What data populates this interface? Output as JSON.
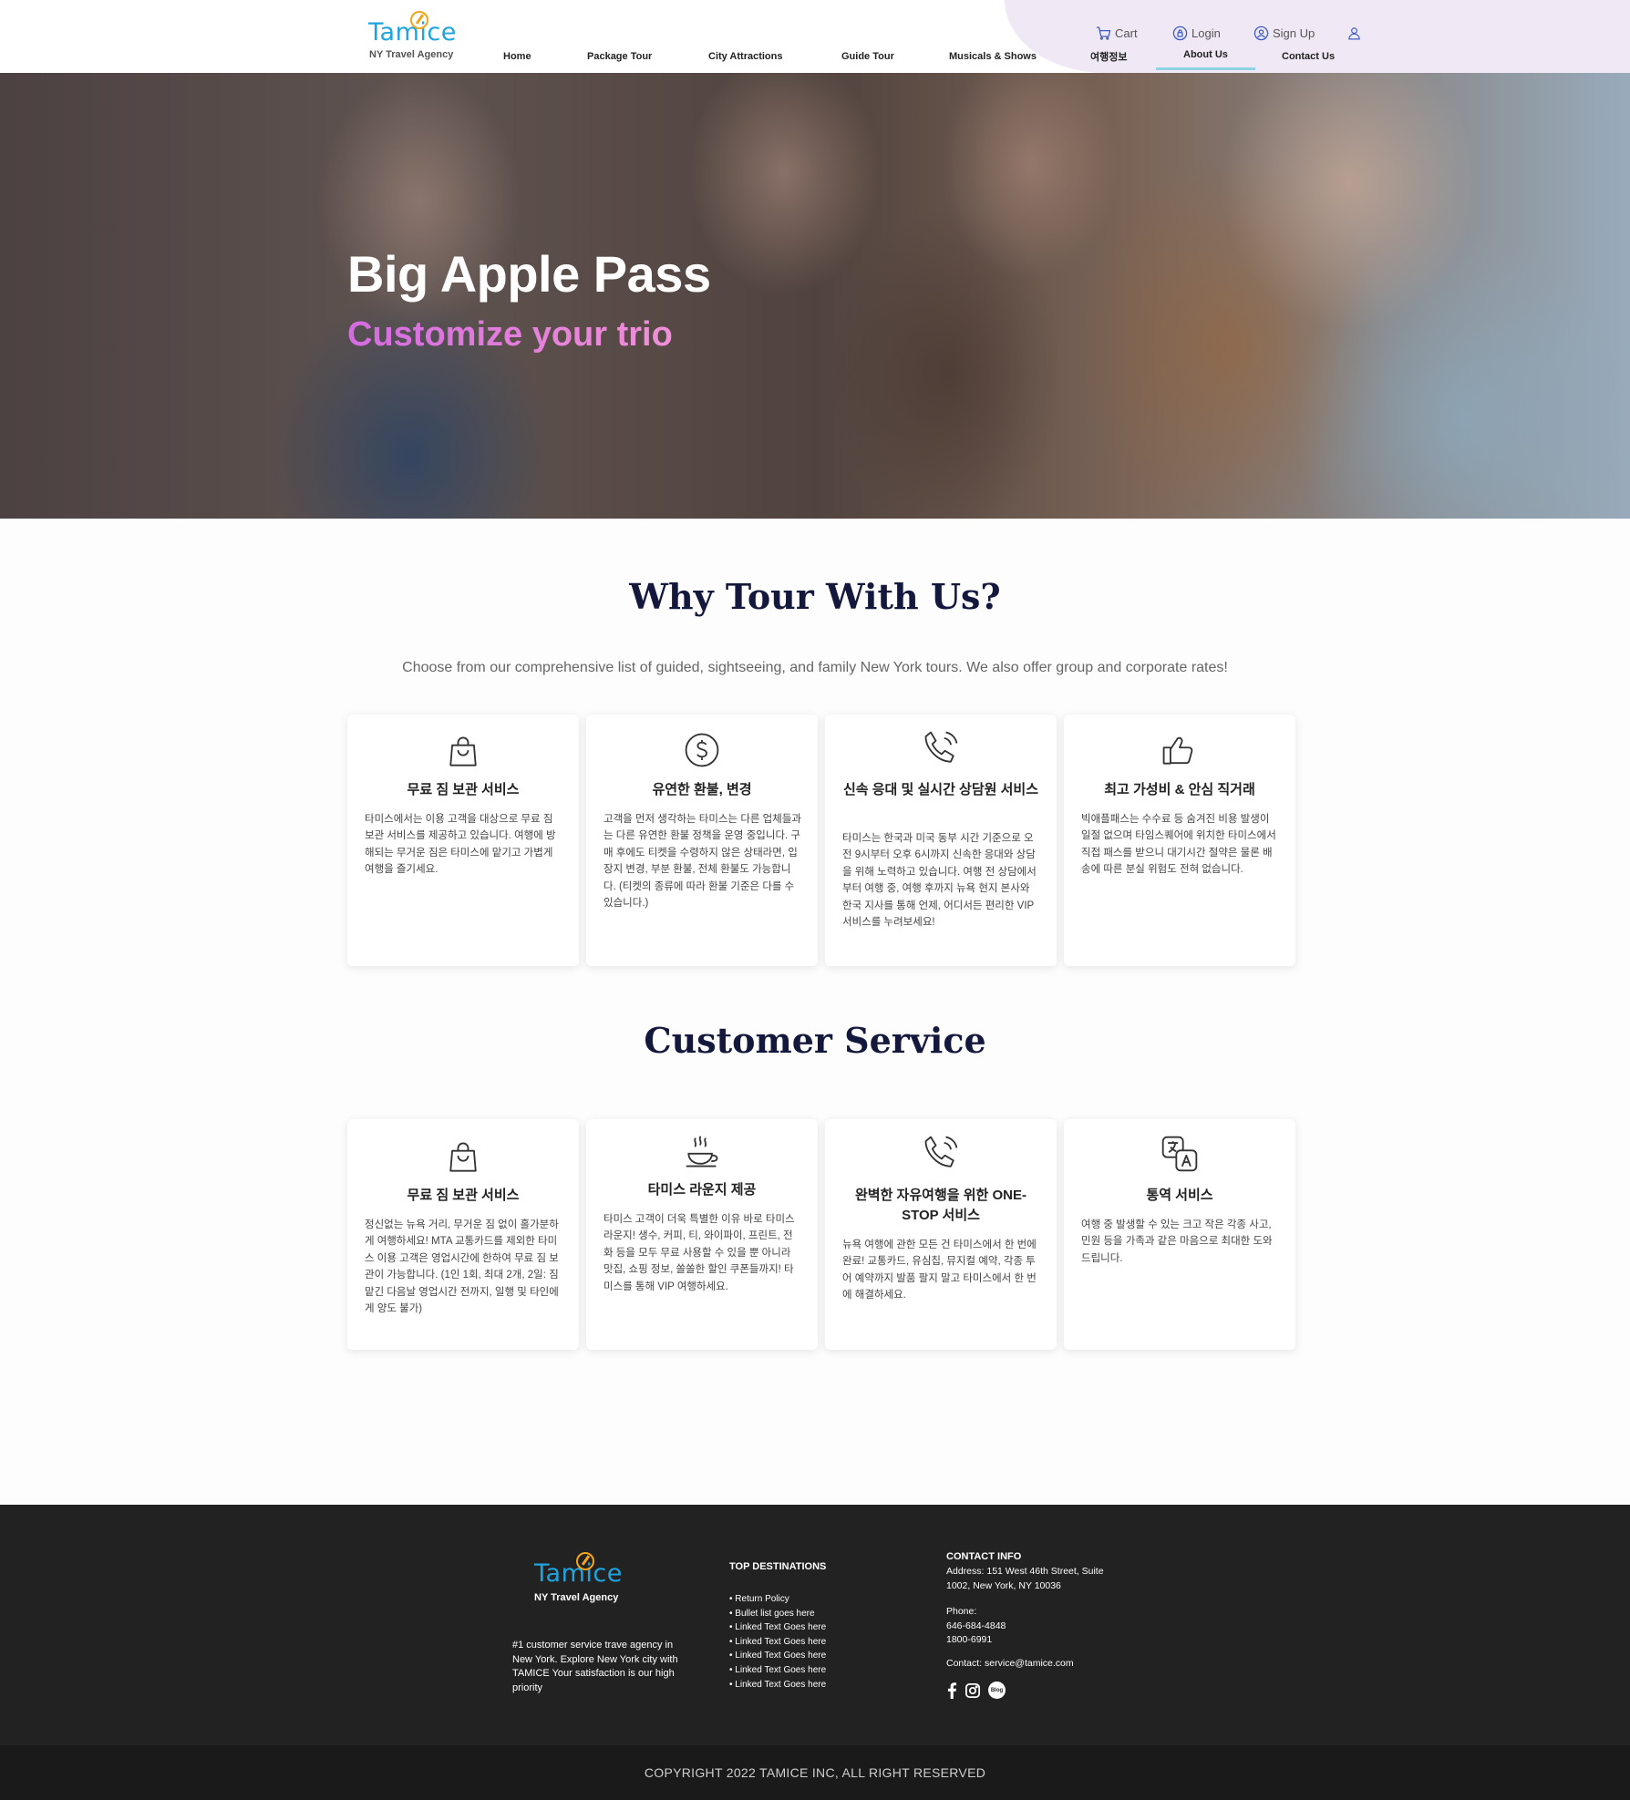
{
  "header": {
    "logo": {
      "word": "Tamice",
      "tagline": "NY Travel Agency"
    },
    "nav": [
      {
        "label": "Home"
      },
      {
        "label": "Package Tour"
      },
      {
        "label": "City Attractions"
      },
      {
        "label": "Guide Tour"
      },
      {
        "label": "Musicals & Shows"
      },
      {
        "label": "여행정보"
      },
      {
        "label": "About Us",
        "active": true
      },
      {
        "label": "Contact Us"
      }
    ],
    "utility": {
      "cart": "Cart",
      "login": "Login",
      "signup": "Sign Up"
    }
  },
  "hero": {
    "title": "Big Apple Pass",
    "subtitle": "Customize your trio"
  },
  "why": {
    "title": "Why Tour With Us?",
    "description": "Choose from our comprehensive list of guided, sightseeing, and family New York tours. We also offer group and corporate rates!",
    "cards": [
      {
        "icon": "shopping-bag-icon",
        "title": "무료 짐 보관 서비스",
        "text": "타미스에서는 이용 고객을 대상으로 무료 짐 보관 서비스를 제공하고 있습니다. 여행에 방해되는 무거운 짐은 타미스에 맡기고 가볍게 여행을 즐기세요."
      },
      {
        "icon": "dollar-circle-icon",
        "title": "유연한 환불, 변경",
        "text": "고객을 먼저 생각하는 타미스는 다른 업체들과는 다른 유연한 환불 정책을 운영 중입니다. 구매 후에도 티켓을 수령하지 않은 상태라면, 입장지 변경, 부분 환불, 전체 환불도 가능합니다. (티켓의 종류에 따라 환불 기준은 다를 수 있습니다.)"
      },
      {
        "icon": "phone-call-icon",
        "title": "신속 응대 및 실시간 상담원 서비스",
        "text": "타미스는 한국과 미국 동부 시간 기준으로 오전 9시부터 오후 6시까지 신속한 응대와 상담을 위해 노력하고 있습니다. 여행 전 상담에서부터 여행 중, 여행 후까지 뉴욕 현지 본사와 한국 지사를 통해 언제, 어디서든 편리한 VIP 서비스를 누려보세요!"
      },
      {
        "icon": "thumbs-up-icon",
        "title": "최고 가성비 & 안심 직거래",
        "text": "빅애플패스는 수수료 등 숨겨진 비용 발생이 일절 없으며 타임스퀘어에 위치한 타미스에서 직접 패스를 받으니 대기시간 절약은 물론 배송에 따른 분실 위험도 전혀 없습니다."
      }
    ]
  },
  "service": {
    "title": "Customer Service",
    "cards": [
      {
        "icon": "shopping-bag-icon",
        "title": "무료 짐 보관 서비스",
        "text": "정신없는 뉴욕 거리, 무거운 짐 없이 홀가분하게 여행하세요! MTA 교통카드를 제외한 타미스 이용 고객은 영업시간에 한하여 무료 짐 보관이 가능합니다. (1인 1회, 최대 2개, 2일: 짐 맡긴 다음날 영업시간 전까지, 일행 및 타인에게 양도 불가)"
      },
      {
        "icon": "coffee-cup-icon",
        "title": "타미스 라운지 제공",
        "text": "타미스 고객이 더욱 특별한 이유 바로 타미스 라운지! 생수, 커피, 티, 와이파이, 프린트, 전화 등을 모두 무료 사용할 수 있을 뿐 아니라 맛집, 쇼핑 정보, 쏠쏠한 할인 쿠폰들까지! 타미스를 통해 VIP 여행하세요."
      },
      {
        "icon": "phone-call-icon",
        "title": "완벽한 자유여행을 위한 ONE-STOP 서비스",
        "text": "뉴욕 여행에 관한 모든 건 타미스에서 한 번에 완료! 교통카드, 유심칩, 뮤지컬 예약, 각종 투어 예약까지 발품 팔지 말고 타미스에서 한 번에 해결하세요."
      },
      {
        "icon": "translate-icon",
        "title": "통역 서비스",
        "text": "여행 중 발생할 수 있는 크고 작은 각종 사고, 민원 등을 가족과 같은 마음으로 최대한 도와드립니다."
      }
    ]
  },
  "footer": {
    "logo": {
      "word": "Tamice",
      "tagline": "NY Travel Agency"
    },
    "tagline": "#1 customer service trave agency in New York. Explore New York city with TAMICE Your satisfaction is our high priority",
    "destinations_heading": "TOP DESTINATIONS",
    "destinations": [
      "Return Policy",
      "Bullet list goes here",
      "Linked Text Goes here",
      "Linked Text Goes here",
      "Linked Text Goes here",
      "Linked Text Goes here",
      "Linked Text Goes here"
    ],
    "contact_heading": "CONTACT INFO",
    "address_line1": "Address: 151 West 46th Street, Suite",
    "address_line2": "1002, New York, NY 10036",
    "phone_label": "Phone:",
    "phone1": "646-684-4848",
    "phone2": "1800-6991",
    "email": "Contact: service@tamice.com",
    "social": [
      "facebook-icon",
      "instagram-icon",
      "blog-icon"
    ],
    "blog_label": "Blog"
  },
  "copyright": "COPYRIGHT 2022 TAMICE INC, ALL RIGHT RESERVED"
}
